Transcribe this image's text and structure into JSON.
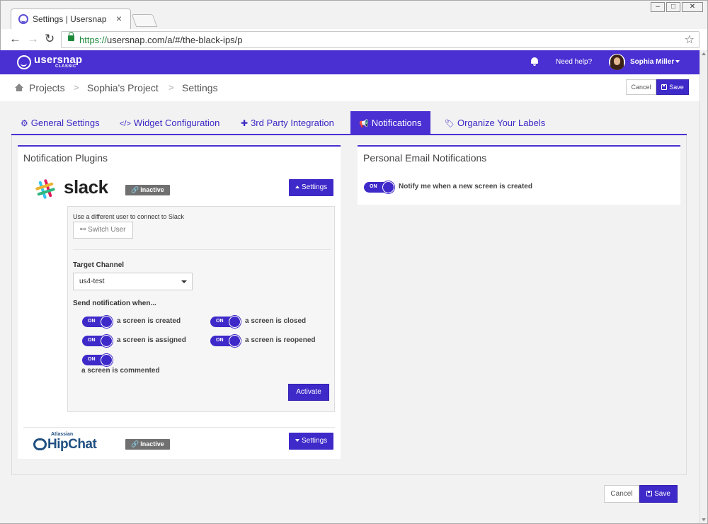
{
  "browser": {
    "tab_title": "Settings | Usersnap",
    "tab_close": "×",
    "url_scheme": "https://",
    "url_rest": "usersnap.com/a/#/the-black-ips/p",
    "back": "←",
    "forward": "→",
    "reload": "↻",
    "star": "☆",
    "min": "–",
    "max": "□",
    "close": "✕"
  },
  "nav": {
    "logo_word": "usersnap",
    "logo_sub": "CLASSIC",
    "help": "Need help?",
    "user": "Sophia Miller"
  },
  "breadcrumb": {
    "items": [
      "Projects",
      "Sophia's Project",
      "Settings"
    ],
    "sep": ">"
  },
  "header_actions": {
    "cancel": "Cancel",
    "save": "Save"
  },
  "tabs": [
    {
      "icon": "⚙",
      "label": "General Settings"
    },
    {
      "icon": "</>",
      "label": "Widget Configuration"
    },
    {
      "icon": "✚",
      "label": "3rd Party Integration"
    },
    {
      "icon": "📢",
      "label": "Notifications"
    },
    {
      "icon": "🏷",
      "label": "Organize Your Labels"
    }
  ],
  "plugins": {
    "title": "Notification Plugins",
    "slack": {
      "name": "slack",
      "status": "Inactive",
      "settings_label": "Settings",
      "switch_hint": "Use a different user to connect to Slack",
      "switch_label": "Switch User",
      "target_label": "Target Channel",
      "target_value": "us4-test",
      "send_label": "Send notification when...",
      "toggles": [
        {
          "state": "ON",
          "label": "a screen is created"
        },
        {
          "state": "ON",
          "label": "a screen is closed"
        },
        {
          "state": "ON",
          "label": "a screen is assigned"
        },
        {
          "state": "ON",
          "label": "a screen is reopened"
        },
        {
          "state": "ON",
          "label": "a screen is commented"
        }
      ],
      "activate_label": "Activate"
    },
    "hipchat": {
      "vendor": "Atlassian",
      "name": "HipChat",
      "status": "Inactive",
      "settings_label": "Settings"
    }
  },
  "email": {
    "title": "Personal Email Notifications",
    "toggle_state": "ON",
    "toggle_label": "Notify me when a new screen is created"
  },
  "footer_actions": {
    "cancel": "Cancel",
    "save": "Save"
  },
  "colors": {
    "brand": "#4a2fd2",
    "button": "#3e29c9",
    "badge": "#707070"
  }
}
